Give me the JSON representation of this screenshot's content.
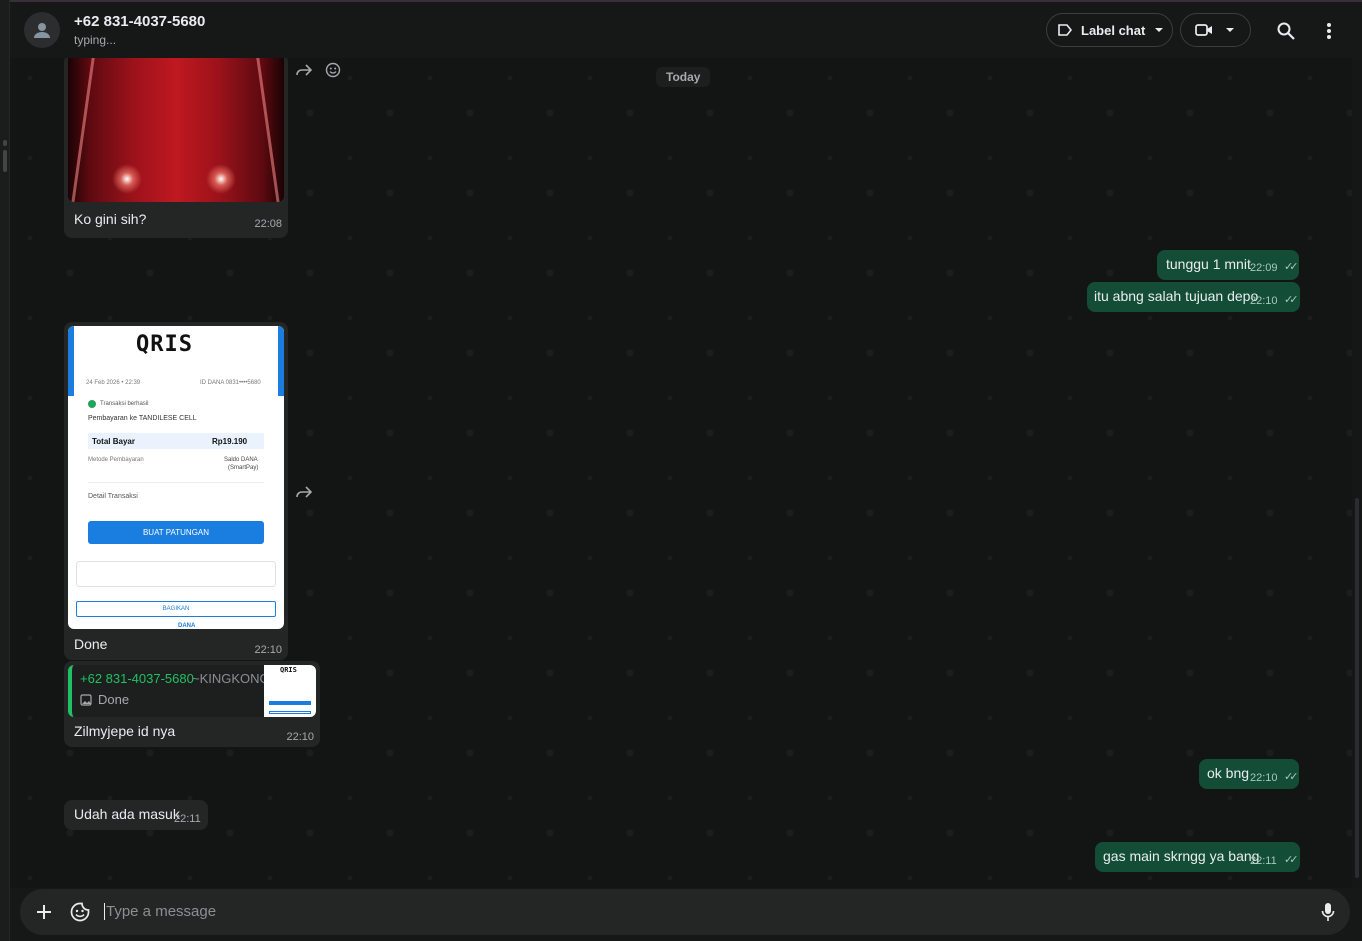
{
  "header": {
    "contact_name": "+62 831-4037-5680",
    "status": "typing...",
    "label_chat": "Label chat"
  },
  "chat": {
    "date_chip": "Today",
    "messages": [
      {
        "dir": "in",
        "type": "image",
        "caption": "Ko gini sih?",
        "time": "22:08"
      },
      {
        "dir": "out",
        "text": "tunggu 1 mnit",
        "time": "22:09"
      },
      {
        "dir": "out",
        "text": "itu abng salah tujuan depo",
        "time": "22:10"
      },
      {
        "dir": "in",
        "type": "image",
        "caption": "Done",
        "time": "22:10"
      },
      {
        "dir": "in",
        "type": "reply",
        "quote_name": "+62 831-4037-5680",
        "quote_nick": "~KINGKONG",
        "quote_text": "Done",
        "text": "Zilmyjepe id nya",
        "time": "22:10"
      },
      {
        "dir": "out",
        "text": "ok bng",
        "time": "22:10"
      },
      {
        "dir": "in",
        "text": "Udah ada masuk",
        "time": "22:11"
      },
      {
        "dir": "out",
        "text": "gas main skrngg ya bang",
        "time": "22:11"
      }
    ]
  },
  "receipt": {
    "logo": "QRIS",
    "date": "24 Feb 2026 • 22:39",
    "id": "ID DANA 0831••••5680",
    "success": "Transaksi berhasil",
    "merchant": "Pembayaran ke TANDILESE CELL",
    "total_label": "Total Bayar",
    "total_value": "Rp19.190",
    "method_label": "Metode Pembayaran",
    "method_value_1": "Saldo DANA",
    "method_value_2": "(SmartPay)",
    "detail_label": "Detail Transaksi",
    "button": "BUAT PATUNGAN",
    "share": "BAGIKAN",
    "footer": "DANA"
  },
  "composer": {
    "placeholder": "Type a message"
  },
  "colors": {
    "incoming": "#242626",
    "outgoing": "#144d37",
    "accent": "#21c063",
    "background": "#131414"
  }
}
